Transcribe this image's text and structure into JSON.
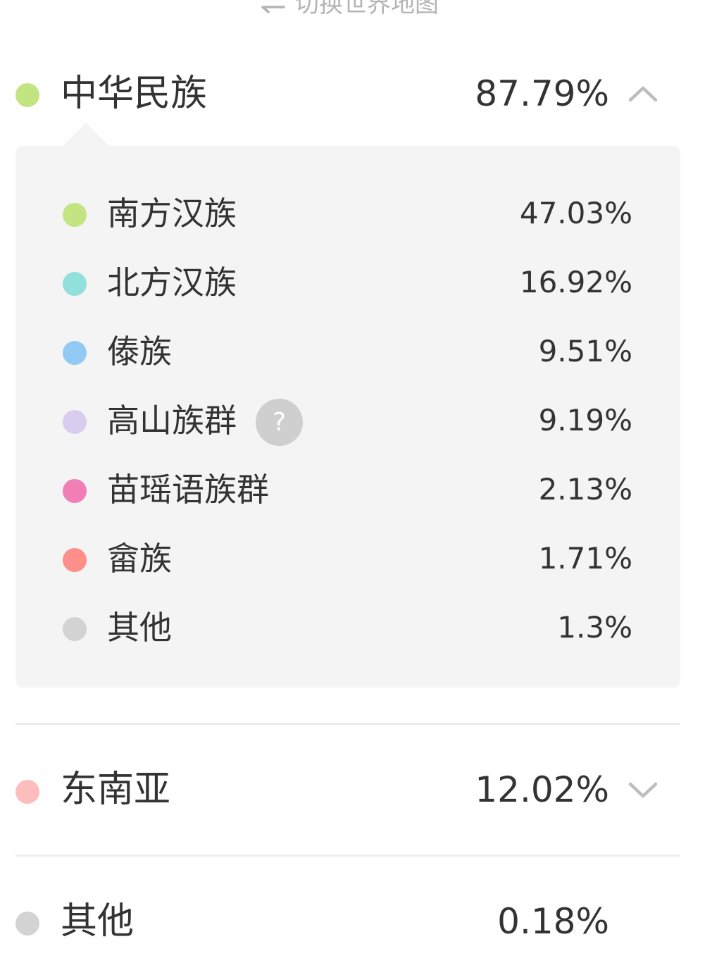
{
  "switch_link": {
    "label": "切换世界地图",
    "icon": "swap-arrows-icon"
  },
  "colors": {
    "chinese": "#c2e582",
    "southeast_asia": "#fdbdbd",
    "other": "#d3d3d3",
    "panel_bg": "#f4f4f4",
    "divider": "#ececec",
    "text": "#333333",
    "muted": "#b4b4b4"
  },
  "groups": [
    {
      "label": "中华民族",
      "percent": "87.79%",
      "color": "#c2e582",
      "expanded": true,
      "toggle_icon": "chevron-up-icon",
      "subgroups": [
        {
          "label": "南方汉族",
          "percent": "47.03%",
          "color": "#c2e582"
        },
        {
          "label": "北方汉族",
          "percent": "16.92%",
          "color": "#92e0dc"
        },
        {
          "label": "傣族",
          "percent": "9.51%",
          "color": "#93caf3"
        },
        {
          "label": "高山族群",
          "percent": "9.19%",
          "color": "#d8cdef",
          "help": "?"
        },
        {
          "label": "苗瑶语族群",
          "percent": "2.13%",
          "color": "#f17fb6"
        },
        {
          "label": "畲族",
          "percent": "1.71%",
          "color": "#fe8f8b"
        },
        {
          "label": "其他",
          "percent": "1.3%",
          "color": "#d3d3d3"
        }
      ]
    },
    {
      "label": "东南亚",
      "percent": "12.02%",
      "color": "#fdbdbd",
      "expanded": false,
      "toggle_icon": "chevron-down-icon"
    },
    {
      "label": "其他",
      "percent": "0.18%",
      "color": "#d3d3d3"
    }
  ]
}
